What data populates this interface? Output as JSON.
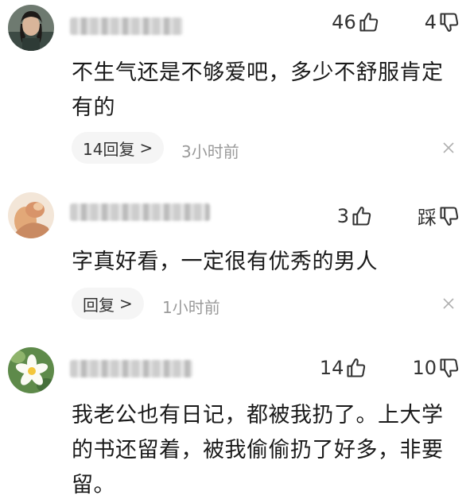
{
  "comments": [
    {
      "likes": "46",
      "dislikes": "4",
      "text": "不生气还是不够爱吧，多少不舒服肯定有的",
      "reply_label": "14回复",
      "reply_chevron": ">",
      "time": "3小时前"
    },
    {
      "likes": "3",
      "dislikes": "踩",
      "text": "字真好看，一定很有优秀的男人",
      "reply_label": "回复",
      "reply_chevron": ">",
      "time": "1小时前"
    },
    {
      "likes": "14",
      "dislikes": "10",
      "text": "我老公也有日记，都被我扔了。上大学的书还留着，被我偷偷扔了好多，非要留。"
    }
  ],
  "icons": {
    "like": "thumbs-up-icon",
    "dislike": "thumbs-down-icon",
    "close": "close-icon"
  }
}
